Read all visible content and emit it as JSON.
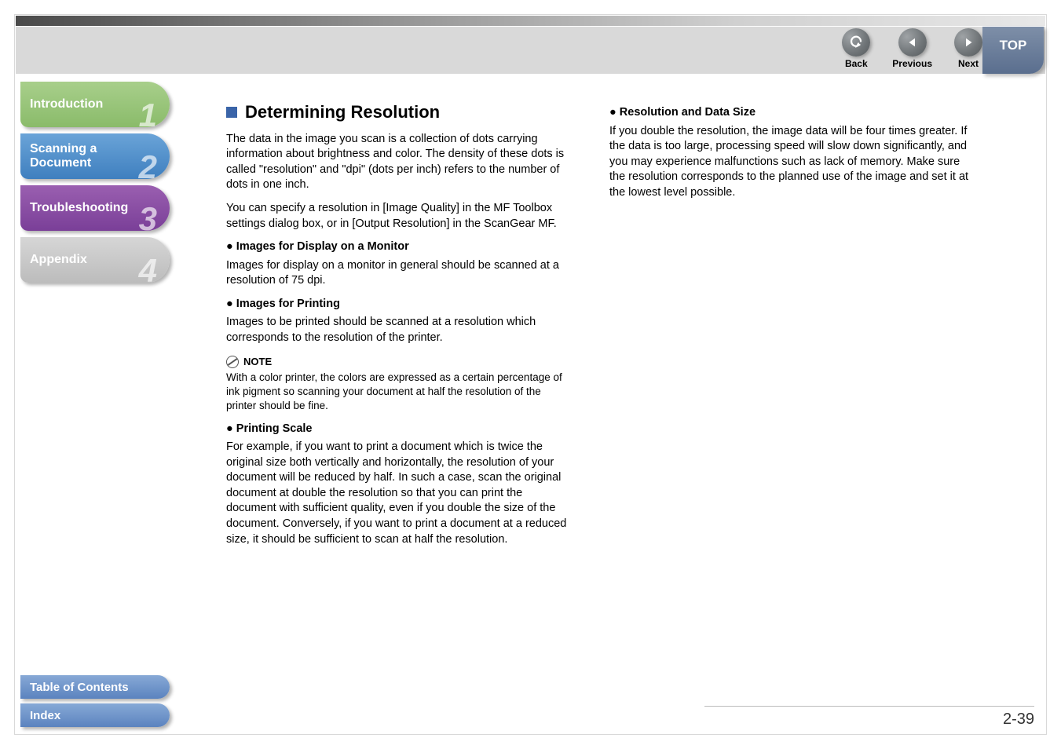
{
  "nav": {
    "back": "Back",
    "previous": "Previous",
    "next": "Next",
    "top": "TOP"
  },
  "sidebar": {
    "items": [
      {
        "label": "Introduction",
        "num": "1"
      },
      {
        "label": "Scanning a Document",
        "num": "2"
      },
      {
        "label": "Troubleshooting",
        "num": "3"
      },
      {
        "label": "Appendix",
        "num": "4"
      }
    ]
  },
  "bottom": {
    "toc": "Table of Contents",
    "index": "Index"
  },
  "left": {
    "title": "Determining Resolution",
    "intro1": "The data in the image you scan is a collection of dots carrying information about brightness and color. The density of these dots is called \"resolution\" and \"dpi\" (dots per inch) refers to the number of dots in one inch.",
    "intro2": "You can specify a resolution in [Image Quality] in the MF Toolbox settings dialog box, or in [Output Resolution] in the ScanGear MF.",
    "h1": "Images for Display on a Monitor",
    "p1": "Images for display on a monitor in general should be scanned at a resolution of 75 dpi.",
    "h2": "Images for Printing",
    "p2": "Images to be printed should be scanned at a resolution which corresponds to the resolution of the printer.",
    "noteLabel": "NOTE",
    "note": "With a color printer, the colors are expressed as a certain percentage of ink pigment so scanning your document at half the resolution of the printer should be fine.",
    "h3": "Printing Scale",
    "p3": "For example, if you want to print a document which is twice the original size both vertically and horizontally, the resolution of your document will be reduced by half. In such a case, scan the original document at double the resolution so that you can print the document with sufficient quality, even if you double the size of the document. Conversely, if you want to print a document at a reduced size, it should be sufficient to scan at half the resolution."
  },
  "right": {
    "h1": "Resolution and Data Size",
    "p1": "If you double the resolution, the image data will be four times greater. If the data is too large, processing speed will slow down significantly, and you may experience malfunctions such as lack of memory. Make sure the resolution corresponds to the planned use of the image and set it at the lowest level possible."
  },
  "pageNumber": "2-39"
}
